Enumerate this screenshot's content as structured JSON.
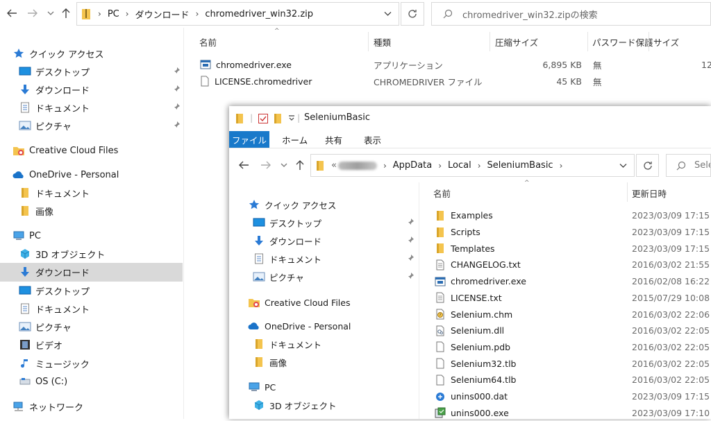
{
  "back": {
    "address": [
      "PC",
      "ダウンロード",
      "chromedriver_win32.zip"
    ],
    "search_placeholder": "chromedriver_win32.zipの検索",
    "columns": [
      "名前",
      "種類",
      "圧縮サイズ",
      "パスワード保護",
      "サイズ"
    ],
    "files": [
      {
        "name": "chromedriver.exe",
        "type": "アプリケーション",
        "size": "6,895 KB",
        "password": "無",
        "extra": "12"
      },
      {
        "name": "LICENSE.chromedriver",
        "type": "CHROMEDRIVER ファイル",
        "size": "45 KB",
        "password": "無",
        "extra": ""
      }
    ],
    "nav": {
      "quick_access": "クイック アクセス",
      "desktop": "デスクトップ",
      "downloads": "ダウンロード",
      "documents": "ドキュメント",
      "pictures": "ピクチャ",
      "creative_cloud": "Creative Cloud Files",
      "onedrive": "OneDrive - Personal",
      "od_documents": "ドキュメント",
      "od_images": "画像",
      "pc": "PC",
      "objects3d": "3D オブジェクト",
      "pc_downloads": "ダウンロード",
      "pc_desktop": "デスクトップ",
      "pc_documents": "ドキュメント",
      "pc_pictures": "ピクチャ",
      "pc_videos": "ビデオ",
      "pc_music": "ミュージック",
      "os_drive": "OS (C:)",
      "network": "ネットワーク"
    }
  },
  "front": {
    "title": "SeleniumBasic",
    "ribbon_tabs": [
      "ファイル",
      "ホーム",
      "共有",
      "表示"
    ],
    "address_prefix": "«",
    "address": [
      "AppData",
      "Local",
      "SeleniumBasic"
    ],
    "search_placeholder": "Sele",
    "columns": [
      "名前",
      "更新日時"
    ],
    "nav": {
      "quick_access": "クイック アクセス",
      "desktop": "デスクトップ",
      "downloads": "ダウンロード",
      "documents": "ドキュメント",
      "pictures": "ピクチャ",
      "creative_cloud": "Creative Cloud Files",
      "onedrive": "OneDrive - Personal",
      "od_documents": "ドキュメント",
      "od_images": "画像",
      "pc": "PC",
      "objects3d": "3D オブジェクト"
    },
    "files": [
      {
        "name": "Examples",
        "date": "2023/03/09 17:15",
        "icon": "folder-icon"
      },
      {
        "name": "Scripts",
        "date": "2023/03/09 17:15",
        "icon": "folder-icon"
      },
      {
        "name": "Templates",
        "date": "2023/03/09 17:15",
        "icon": "folder-icon"
      },
      {
        "name": "CHANGELOG.txt",
        "date": "2016/03/02 21:55",
        "icon": "text-file-icon"
      },
      {
        "name": "chromedriver.exe",
        "date": "2016/02/08 16:22",
        "icon": "exe-icon"
      },
      {
        "name": "LICENSE.txt",
        "date": "2015/07/29 10:08",
        "icon": "text-file-icon"
      },
      {
        "name": "Selenium.chm",
        "date": "2016/03/02 22:06",
        "icon": "help-file-icon"
      },
      {
        "name": "Selenium.dll",
        "date": "2016/03/02 22:05",
        "icon": "dll-icon"
      },
      {
        "name": "Selenium.pdb",
        "date": "2016/03/02 22:05",
        "icon": "blank-file-icon"
      },
      {
        "name": "Selenium32.tlb",
        "date": "2016/03/02 22:05",
        "icon": "blank-file-icon"
      },
      {
        "name": "Selenium64.tlb",
        "date": "2016/03/02 22:05",
        "icon": "blank-file-icon"
      },
      {
        "name": "unins000.dat",
        "date": "2023/03/09 17:15",
        "icon": "dat-file-icon"
      },
      {
        "name": "unins000.exe",
        "date": "2023/03/09 17:10",
        "icon": "installer-icon"
      }
    ]
  },
  "colors": {
    "ribbon_blue": "#1979ca",
    "folder_yellow": "#f4c44e",
    "selection_gray": "#d9d9d9"
  }
}
